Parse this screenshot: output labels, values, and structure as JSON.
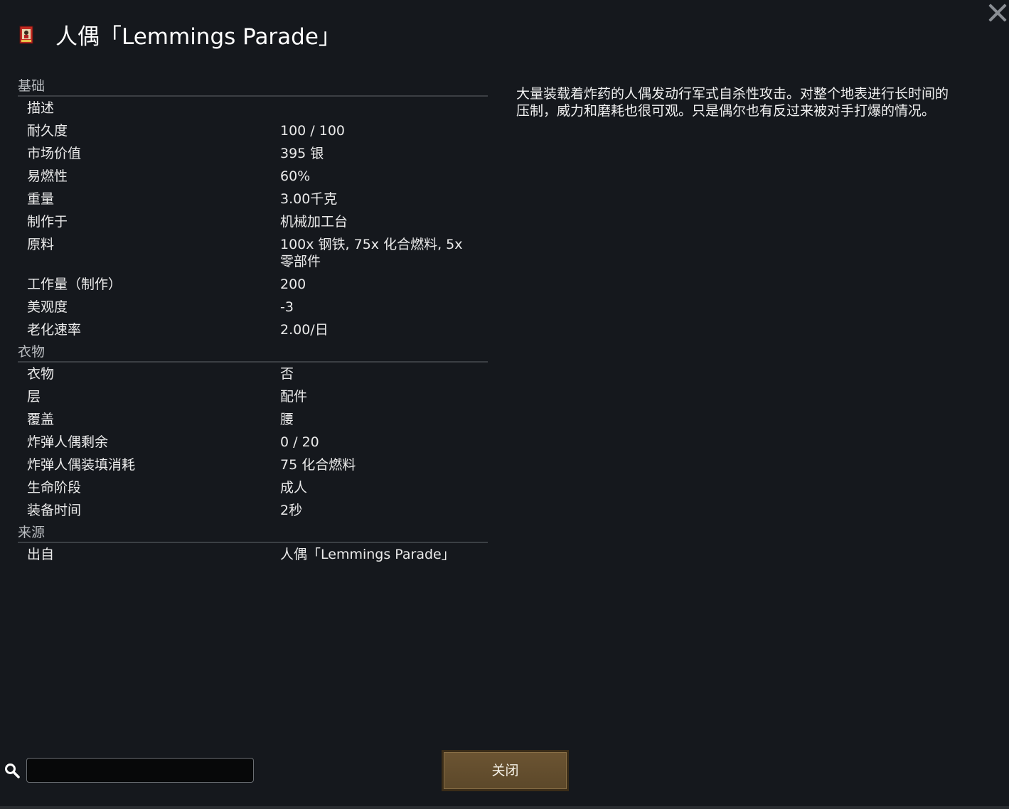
{
  "window": {
    "title": "人偶「Lemmings Parade」",
    "icon": "bomb-doll-card-icon"
  },
  "sections": [
    {
      "header": "基础",
      "rows": [
        {
          "label": "描述",
          "value": ""
        },
        {
          "label": "耐久度",
          "value": "100 / 100"
        },
        {
          "label": "市场价值",
          "value": "395 银"
        },
        {
          "label": "易燃性",
          "value": "60%"
        },
        {
          "label": "重量",
          "value": "3.00千克"
        },
        {
          "label": "制作于",
          "value": "机械加工台"
        },
        {
          "label": "原料",
          "value": "100x 钢铁, 75x 化合燃料, 5x 零部件"
        },
        {
          "label": "工作量（制作）",
          "value": "200"
        },
        {
          "label": "美观度",
          "value": "-3"
        },
        {
          "label": "老化速率",
          "value": "2.00/日"
        }
      ]
    },
    {
      "header": "衣物",
      "rows": [
        {
          "label": "衣物",
          "value": "否"
        },
        {
          "label": "层",
          "value": "配件"
        },
        {
          "label": "覆盖",
          "value": "腰"
        },
        {
          "label": "炸弹人偶剩余",
          "value": "0 / 20"
        },
        {
          "label": "炸弹人偶装填消耗",
          "value": "75 化合燃料"
        },
        {
          "label": "生命阶段",
          "value": "成人"
        },
        {
          "label": "装备时间",
          "value": "2秒"
        }
      ]
    },
    {
      "header": "来源",
      "rows": [
        {
          "label": "出自",
          "value": "人偶「Lemmings Parade」"
        }
      ]
    }
  ],
  "description": "大量装载着炸药的人偶发动行军式自杀性攻击。对整个地表进行长时间的压制，威力和磨耗也很可观。只是偶尔也有反过来被对手打爆的情况。",
  "search": {
    "value": "",
    "icon": "search-icon"
  },
  "close_button_label": "关闭",
  "colors": {
    "background": "#15181d",
    "button": "#5f4a2c"
  }
}
